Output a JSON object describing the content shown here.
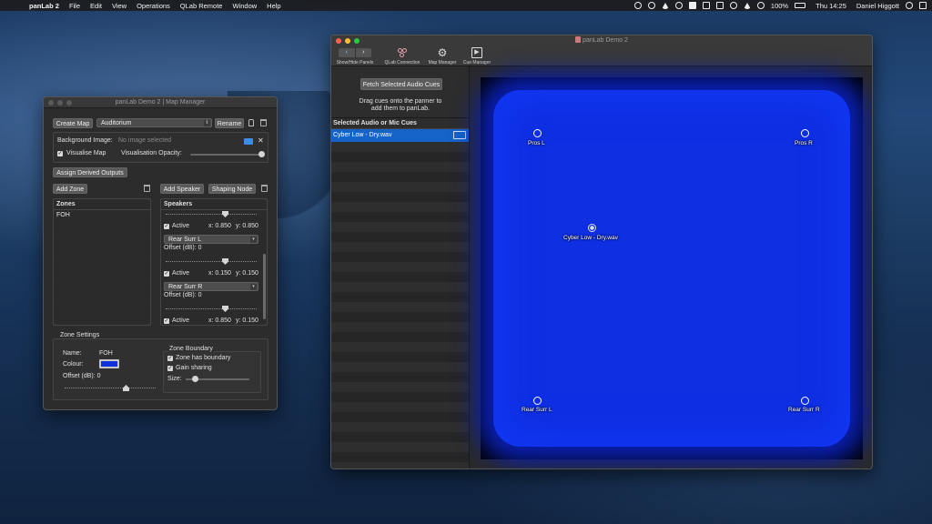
{
  "menubar": {
    "app": "panLab 2",
    "items": [
      "File",
      "Edit",
      "View",
      "Operations",
      "QLab Remote",
      "Window",
      "Help"
    ],
    "battery": "100%",
    "clock": "Thu 14:25",
    "user": "Daniel Higgott"
  },
  "map_manager": {
    "title": "panLab Demo 2 | Map Manager",
    "create_map": "Create Map",
    "map_select": "Auditorium",
    "rename": "Rename",
    "background_image_label": "Background Image:",
    "background_image_value": "No image selected",
    "visualise_map": "Visualise Map",
    "visualisation_opacity": "Visualisation Opacity:",
    "assign_derived_outputs": "Assign Derived Outputs",
    "add_zone": "Add Zone",
    "add_speaker": "Add Speaker",
    "shaping_node": "Shaping Node",
    "zones_header": "Zones",
    "zones": [
      "FOH"
    ],
    "speakers_header": "Speakers",
    "speakers": [
      {
        "name": "",
        "active_label": "Active",
        "x": "x: 0.850",
        "y": "y: 0.850"
      },
      {
        "name": "Rear Surr L",
        "offset": "Offset (dB): 0",
        "active_label": "Active",
        "x": "x: 0.150",
        "y": "y: 0.150"
      },
      {
        "name": "Rear Surr R",
        "offset": "Offset (dB): 0",
        "active_label": "Active",
        "x": "x: 0.850",
        "y": "y: 0.150"
      }
    ],
    "zone_settings": {
      "header": "Zone Settings",
      "name_label": "Name:",
      "name_value": "FOH",
      "colour_label": "Colour:",
      "colour": "#1230d8",
      "offset": "Offset (dB): 0",
      "boundary_header": "Zone Boundary",
      "has_boundary": "Zone has boundary",
      "gain_sharing": "Gain sharing",
      "size_label": "Size:"
    }
  },
  "main_window": {
    "title": "panLab Demo 2",
    "toolbar": {
      "show_hide_panels": "Show/Hide Panels",
      "qlab_connection": "QLab Connection",
      "map_manager": "Map Manager",
      "cue_manager": "Cue Manager"
    },
    "fetch_button": "Fetch Selected Audio Cues",
    "fetch_hint_1": "Drag cues onto the panner to",
    "fetch_hint_2": "add them to panLab.",
    "cue_list_header": "Selected Audio or Mic Cues",
    "cues": [
      "Cyber Low - Dry.wav"
    ],
    "panner": {
      "speakers": [
        "Pros L",
        "Pros R",
        "Rear Surr L",
        "Rear Surr R"
      ],
      "source": "Cyber Low - Dry.wav"
    }
  }
}
